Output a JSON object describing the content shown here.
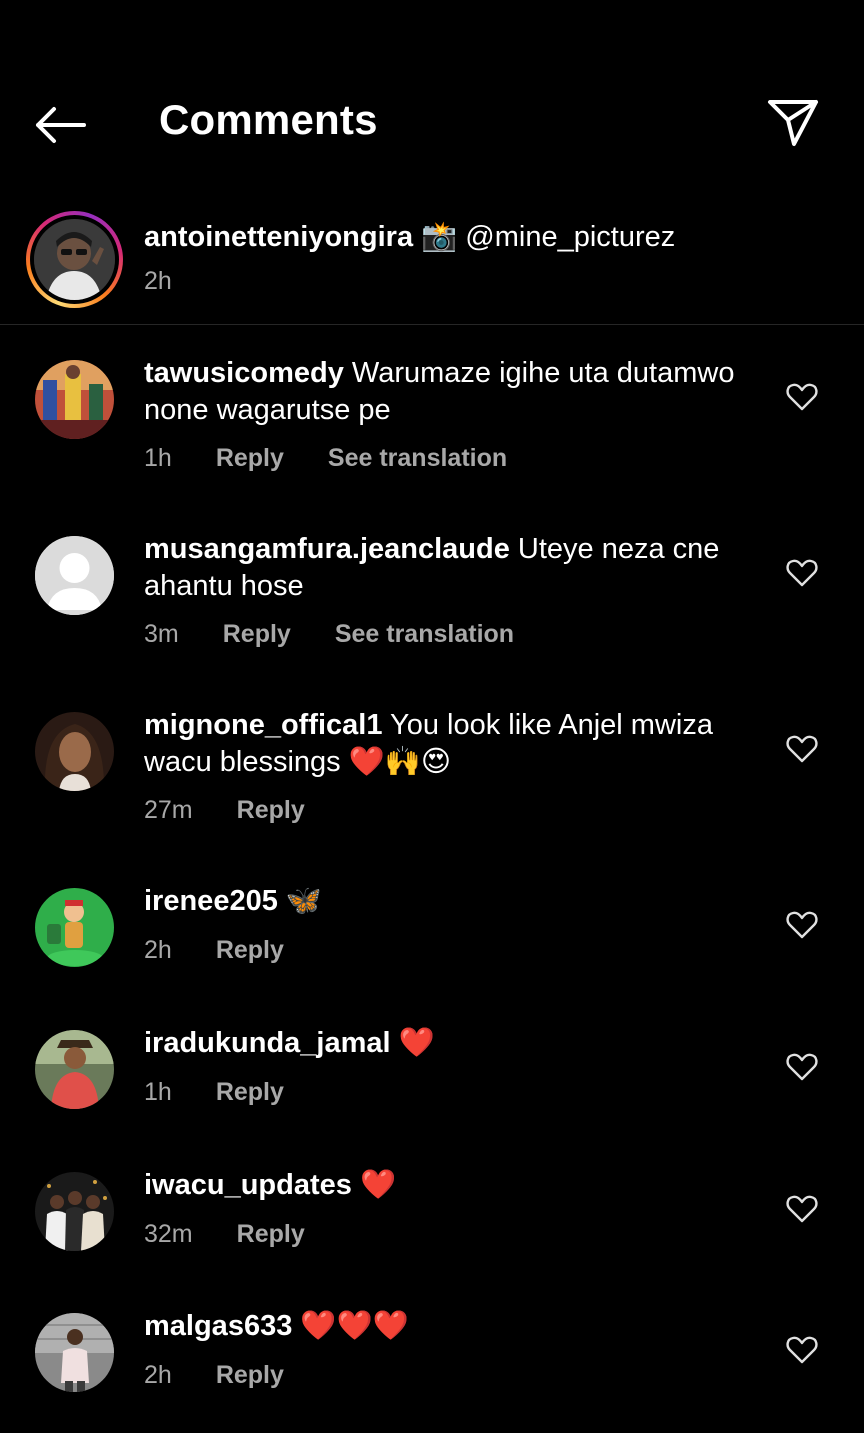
{
  "header": {
    "title": "Comments",
    "back_icon": "arrow-left-icon",
    "share_icon": "paper-plane-icon"
  },
  "caption": {
    "username": "antoinetteniyongira",
    "text": "📸 @mine_picturez",
    "time": "2h"
  },
  "comments": [
    {
      "username": "tawusicomedy",
      "text": "Warumaze igihe uta dutamwo none wagarutse pe",
      "time": "1h",
      "reply": "Reply",
      "translation": "See translation"
    },
    {
      "username": "musangamfura.jeanclaude",
      "text": "Uteye neza cne ahantu hose",
      "time": "3m",
      "reply": "Reply",
      "translation": "See translation"
    },
    {
      "username": "mignone_offical1",
      "text": "You look like Anjel mwiza wacu blessings ❤️🙌😍",
      "time": "27m",
      "reply": "Reply"
    },
    {
      "username": "irenee205",
      "text": "🦋",
      "time": "2h",
      "reply": "Reply"
    },
    {
      "username": "iradukunda_jamal",
      "text": "❤️",
      "time": "1h",
      "reply": "Reply"
    },
    {
      "username": "iwacu_updates",
      "text": "❤️",
      "time": "32m",
      "reply": "Reply"
    },
    {
      "username": "malgas633",
      "text": "❤️❤️❤️",
      "time": "2h",
      "reply": "Reply"
    }
  ],
  "colors": {
    "background": "#000000",
    "text": "#ffffff",
    "secondary_text": "#a8a8a8",
    "divider": "#262626"
  }
}
